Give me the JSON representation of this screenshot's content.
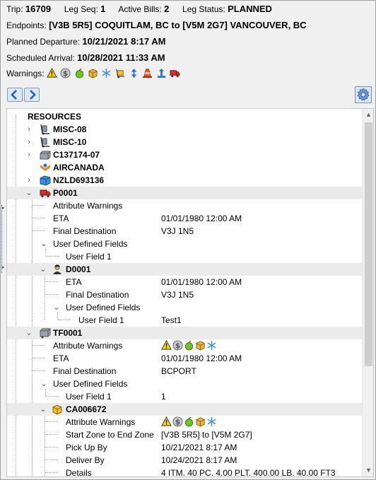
{
  "header": {
    "trip_label": "Trip:",
    "trip_value": "16709",
    "legseq_label": "Leg Seq:",
    "legseq_value": "1",
    "activebills_label": "Active Bills:",
    "activebills_value": "2",
    "legstatus_label": "Leg Status:",
    "legstatus_value": "PLANNED",
    "endpoints_label": "Endpoints:",
    "endpoints_value": "[V3B 5R5] COQUITLAM, BC to [V5M 2G7] VANCOUVER, BC",
    "planned_departure_label": "Planned Departure:",
    "planned_departure_value": "10/21/2021 8:17 AM",
    "scheduled_arrival_label": "Scheduled Arrival:",
    "scheduled_arrival_value": "10/28/2021 11:33 AM",
    "warnings_label": "Warnings:",
    "warning_icons": [
      "warning-triangle-icon",
      "dollar-coin-icon",
      "green-apple-icon",
      "package-box-icon",
      "snowflake-icon",
      "hand-truck-icon",
      "up-down-arrows-icon",
      "traffic-cone-icon",
      "high-lift-icon",
      "red-truck-icon"
    ]
  },
  "toolbar": {
    "back_icon": "arrow-left-icon",
    "forward_icon": "arrow-right-icon",
    "settings_icon": "gear-icon"
  },
  "tree": {
    "root_label": "RESOURCES",
    "resources": [
      {
        "label": "MISC-08",
        "icon": "hand-truck-icon"
      },
      {
        "label": "MISC-10",
        "icon": "hand-truck-icon"
      },
      {
        "label": "C137174-07",
        "icon": "container-icon"
      },
      {
        "label": "AIRCANADA",
        "icon": "carrier-icon"
      },
      {
        "label": "NZLD693136",
        "icon": "cube-container-icon"
      }
    ],
    "p0001": {
      "label": "P0001",
      "icon": "red-truck-icon",
      "attribute_warnings": "Attribute Warnings",
      "eta_label": "ETA",
      "eta_value": "01/01/1980 12:00 AM",
      "final_dest_label": "Final Destination",
      "final_dest_value": "V3J 1N5",
      "udf_label": "User Defined Fields",
      "uf1_label": "User Field 1",
      "uf1_value": ""
    },
    "d0001": {
      "label": "D0001",
      "icon": "driver-icon",
      "eta_label": "ETA",
      "eta_value": "01/01/1980 12:00 AM",
      "final_dest_label": "Final Destination",
      "final_dest_value": "V3J 1N5",
      "udf_label": "User Defined Fields",
      "uf1_label": "User Field 1",
      "uf1_value": "Test1"
    },
    "tf0001": {
      "label": "TF0001",
      "icon": "trailer-icon",
      "attribute_warnings": "Attribute Warnings",
      "eta_label": "ETA",
      "eta_value": "01/01/1980 12:00 AM",
      "final_dest_label": "Final Destination",
      "final_dest_value": "BCPORT",
      "udf_label": "User Defined Fields",
      "uf1_label": "User Field 1",
      "uf1_value": "1"
    },
    "ca006672": {
      "label": "CA006672",
      "icon": "package-box-icon",
      "attribute_warnings": "Attribute Warnings",
      "zone_label": "Start Zone to End Zone",
      "zone_value": "[V3B 5R5] to [V5M 2G7]",
      "pickup_label": "Pick Up By",
      "pickup_value": "10/21/2021 8:17 AM",
      "deliver_label": "Deliver By",
      "deliver_value": "10/24/2021 8:17 AM",
      "details_label": "Details",
      "details_value": "4 ITM. 40 PC. 4.00 PLT. 400.00 LB. 40.00 FT3"
    }
  },
  "colors": {
    "accent": "#2b6cd4",
    "shade_row": "#ebebeb"
  }
}
